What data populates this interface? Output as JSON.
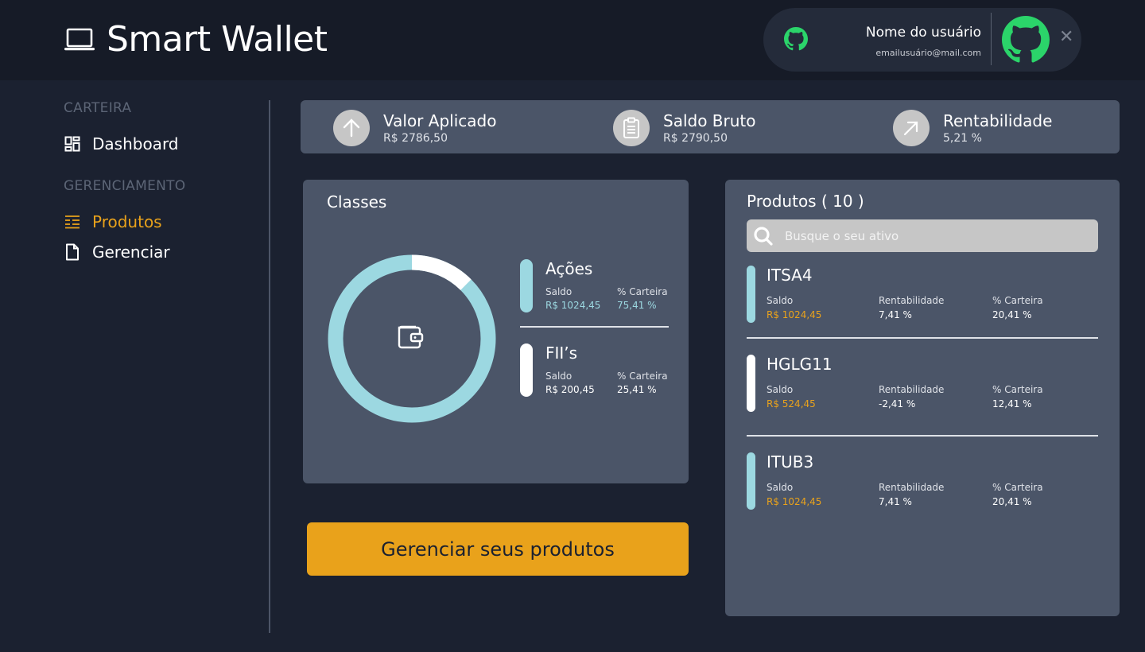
{
  "app": {
    "title": "Smart Wallet",
    "icon": "laptop-icon"
  },
  "user": {
    "name": "Nome do usuário",
    "email": "emailusuário@mail.com",
    "left_icon": "github-icon",
    "avatar_icon": "github-icon",
    "close_label": "✕"
  },
  "sidebar": {
    "sections": [
      {
        "title": "CARTEIRA",
        "items": [
          {
            "label": "Dashboard",
            "icon": "dashboard-icon",
            "active": false
          }
        ]
      },
      {
        "title": "GERENCIAMENTO",
        "items": [
          {
            "label": "Produtos",
            "icon": "list-icon",
            "active": true
          },
          {
            "label": "Gerenciar",
            "icon": "document-icon",
            "active": false
          }
        ]
      }
    ]
  },
  "stats": [
    {
      "label": "Valor Aplicado",
      "value": "R$ 2786,50",
      "icon": "arrow-up-icon"
    },
    {
      "label": "Saldo Bruto",
      "value": "R$ 2790,50",
      "icon": "clipboard-icon"
    },
    {
      "label": "Rentabilidade",
      "value": "5,21 %",
      "icon": "arrow-up-right-icon"
    }
  ],
  "classes": {
    "title": "Classes",
    "center_icon": "wallet-icon",
    "items": [
      {
        "name": "Ações",
        "saldo_label": "Saldo",
        "saldo": "R$ 1024,45",
        "pct_label": "% Carteira",
        "pct": "75,41 %",
        "color": "#9cd8e1",
        "value_color": "#9cd8e1"
      },
      {
        "name": "FII’s",
        "saldo_label": "Saldo",
        "saldo": "R$ 200,45",
        "pct_label": "% Carteira",
        "pct": "25,41 %",
        "color": "#ffffff",
        "value_color": "#ffffff"
      }
    ],
    "chart_data": {
      "type": "pie",
      "categories": [
        "Ações",
        "FII’s"
      ],
      "values": [
        75.41,
        25.41
      ],
      "colors": [
        "#9cd8e1",
        "#ffffff"
      ]
    }
  },
  "manage_button": {
    "label": "Gerenciar seus produtos"
  },
  "products": {
    "title": "Produtos ( 10 )",
    "search_placeholder": "Busque o seu ativo",
    "search_icon": "search-icon",
    "columns": {
      "saldo": "Saldo",
      "rent": "Rentabilidade",
      "pct": "% Carteira"
    },
    "items": [
      {
        "name": "ITSA4",
        "saldo": "R$ 1024,45",
        "rent": "7,41 %",
        "pct": "20,41 %",
        "color": "#9cd8e1"
      },
      {
        "name": "HGLG11",
        "saldo": "R$ 524,45",
        "rent": "-2,41 %",
        "pct": "12,41 %",
        "color": "#ffffff"
      },
      {
        "name": "ITUB3",
        "saldo": "R$ 1024,45",
        "rent": "7,41 %",
        "pct": "20,41 %",
        "color": "#9cd8e1"
      }
    ]
  },
  "colors": {
    "background": "#1b2130",
    "header": "#161b27",
    "card": "#4b5568",
    "accent": "#e9a21b",
    "teal": "#9cd8e1",
    "github_green": "#2bd46a"
  }
}
